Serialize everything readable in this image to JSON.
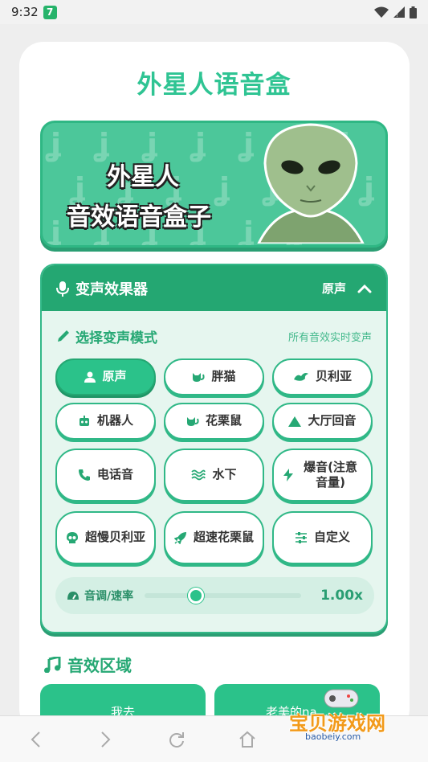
{
  "status_bar": {
    "time": "9:32",
    "app_badge": "7"
  },
  "app_title": "外星人语音盒",
  "banner": {
    "line1": "外星人",
    "line2": "音效语音盒子"
  },
  "voice_panel": {
    "title": "变声效果器",
    "current_mode": "原声",
    "subtitle": "选择变声模式",
    "hint": "所有音效实时变声",
    "modes": [
      {
        "label": "原声",
        "icon": "person-icon",
        "active": true
      },
      {
        "label": "胖猫",
        "icon": "cat-icon"
      },
      {
        "label": "贝利亚",
        "icon": "dragon-icon"
      },
      {
        "label": "机器人",
        "icon": "robot-icon"
      },
      {
        "label": "花栗鼠",
        "icon": "cat-icon"
      },
      {
        "label": "大厅回音",
        "icon": "mountain-icon"
      },
      {
        "label": "电话音",
        "icon": "phone-icon"
      },
      {
        "label": "水下",
        "icon": "water-icon"
      },
      {
        "label": "爆音(注意音量)",
        "icon": "bolt-icon"
      },
      {
        "label": "超慢贝利亚",
        "icon": "skull-icon"
      },
      {
        "label": "超速花栗鼠",
        "icon": "rocket-icon"
      },
      {
        "label": "自定义",
        "icon": "sliders-icon"
      }
    ],
    "pitch": {
      "label": "音调/速率",
      "value": "1.00x",
      "level": 0.33
    }
  },
  "sound_section": {
    "title": "音效区域",
    "items": [
      "我去",
      "老美的na..."
    ]
  },
  "watermark": {
    "text": "宝贝游戏网",
    "url": "baobeiy.com"
  },
  "colors": {
    "primary": "#2bc28a",
    "header": "#24a772",
    "title": "#2fc493"
  }
}
